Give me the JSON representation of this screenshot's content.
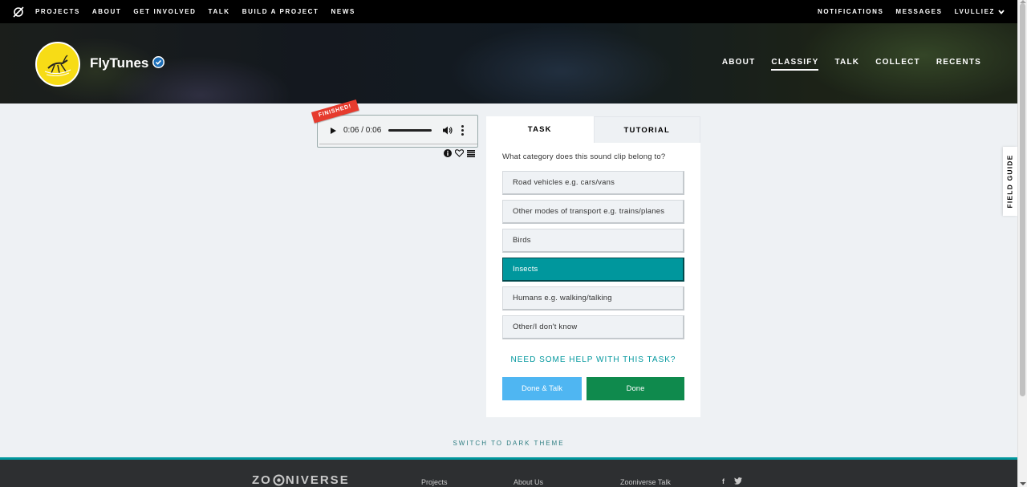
{
  "topnav": {
    "left_items": [
      "PROJECTS",
      "ABOUT",
      "GET INVOLVED",
      "TALK",
      "BUILD A PROJECT",
      "NEWS"
    ],
    "notifications": "NOTIFICATIONS",
    "messages": "MESSAGES",
    "user": "LVULLIEZ"
  },
  "project": {
    "title": "FlyTunes",
    "nav": [
      "ABOUT",
      "CLASSIFY",
      "TALK",
      "COLLECT",
      "RECENTS"
    ],
    "active_nav": "CLASSIFY"
  },
  "player": {
    "ribbon": "FINISHED!",
    "time": "0:06 / 0:06",
    "progress": 1.0
  },
  "task": {
    "tabs": [
      "TASK",
      "TUTORIAL"
    ],
    "question": "What category does this sound clip belong to?",
    "answers": [
      "Road vehicles e.g. cars/vans",
      "Other modes of transport e.g. trains/planes",
      "Birds",
      "Insects",
      "Humans e.g. walking/talking",
      "Other/I don't know"
    ],
    "selected_answer": "Insects",
    "help": "NEED SOME HELP WITH THIS TASK?",
    "done_talk": "Done & Talk",
    "done": "Done"
  },
  "field_guide": "FIELD GUIDE",
  "dark_theme": "SWITCH TO DARK THEME",
  "footer": {
    "brand_left": "ZO",
    "brand_right": "NIVERSE",
    "links": [
      "Projects",
      "About Us",
      "Zooniverse Talk"
    ],
    "social": [
      "f",
      "twitter-icon"
    ]
  },
  "colors": {
    "accent": "#00979d",
    "done": "#0f8a4d",
    "done_talk": "#4fb6f2",
    "ribbon": "#e63b2e",
    "avatar_bg": "#f7dc16"
  }
}
